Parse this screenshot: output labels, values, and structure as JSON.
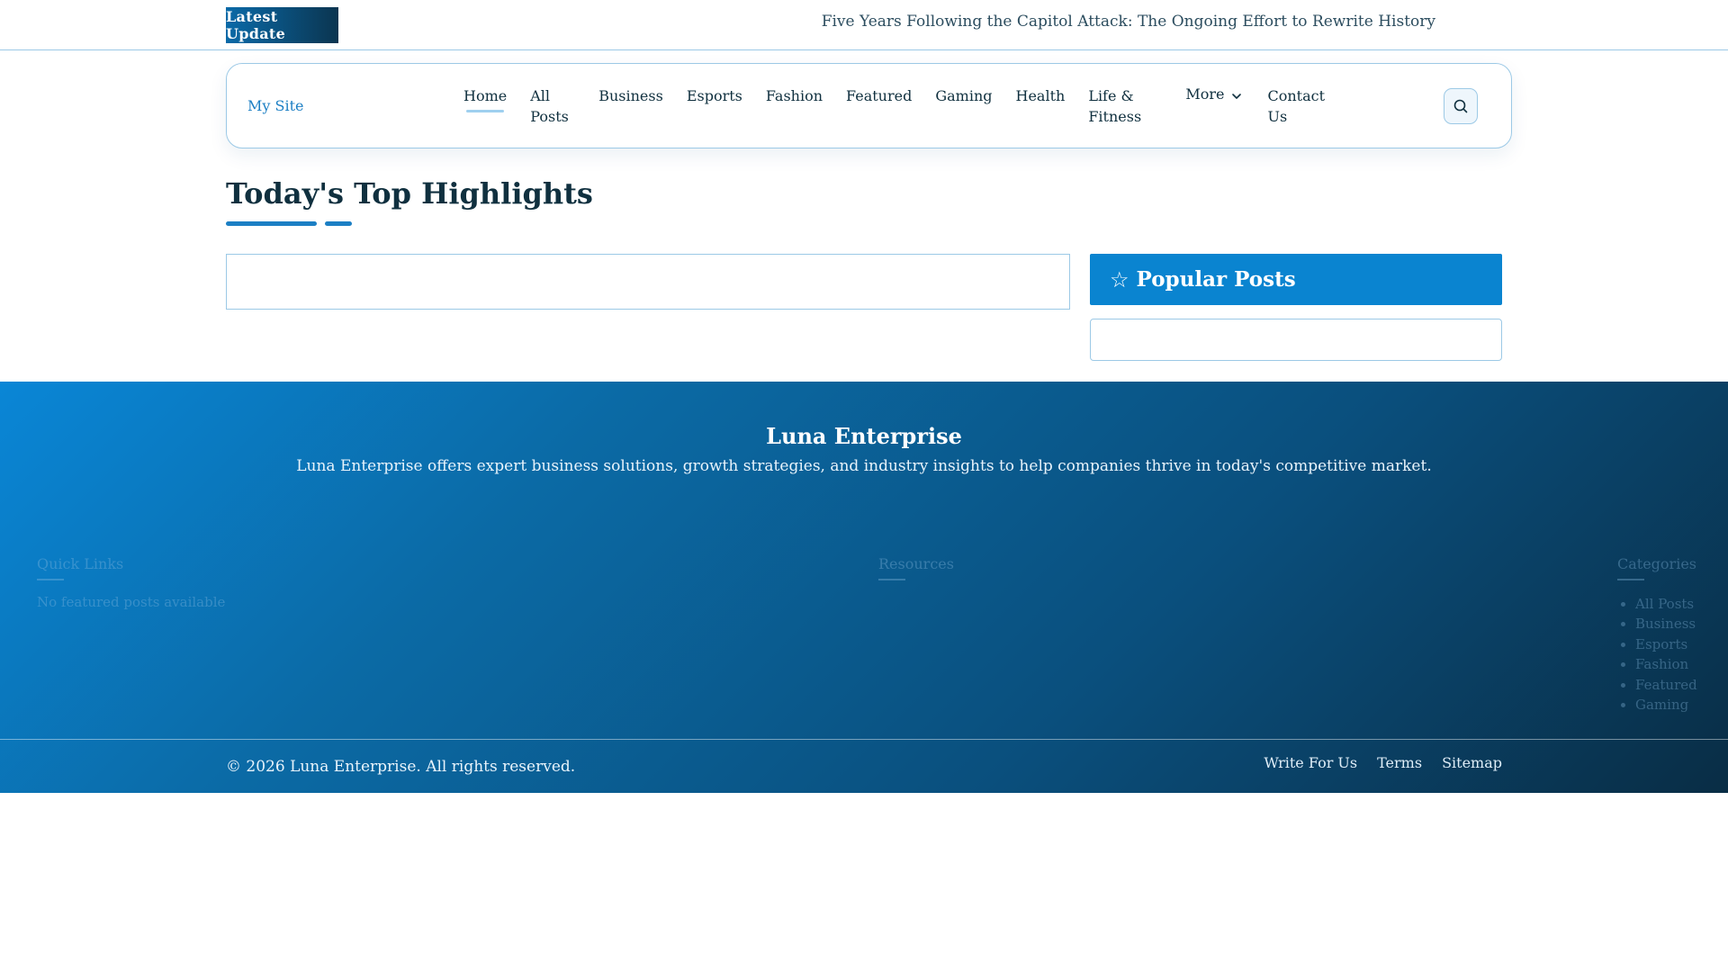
{
  "ticker": {
    "badge": "Latest  Update",
    "headline": "Five Years Following the Capitol Attack: The Ongoing Effort to Rewrite History"
  },
  "header": {
    "site_title": "My Site",
    "nav": [
      "Home",
      "All Posts",
      "Business",
      "Esports",
      "Fashion",
      "Featured",
      "Gaming",
      "Health",
      "Life & Fitness",
      "More",
      "Contact Us"
    ]
  },
  "highlights": {
    "title": "Today's Top Highlights"
  },
  "popular": {
    "title": "Popular Posts"
  },
  "footer": {
    "brand": "Luna Enterprise",
    "description": "Luna Enterprise offers expert business solutions, growth strategies, and industry insights to help companies thrive in today's competitive market.",
    "quick_links_title": "Quick Links",
    "quick_links_text": "No featured posts available",
    "resources_title": "Resources",
    "categories_title": "Categories",
    "categories": [
      "All Posts",
      "Business",
      "Esports",
      "Fashion",
      "Featured",
      "Gaming"
    ],
    "copyright": "© 2026 Luna Enterprise. All rights reserved.",
    "links": [
      "Write For Us",
      "Terms",
      "Sitemap"
    ]
  },
  "colors": {
    "accent": "#0a84d0",
    "border": "#9cc9e6",
    "text": "#10303f"
  }
}
